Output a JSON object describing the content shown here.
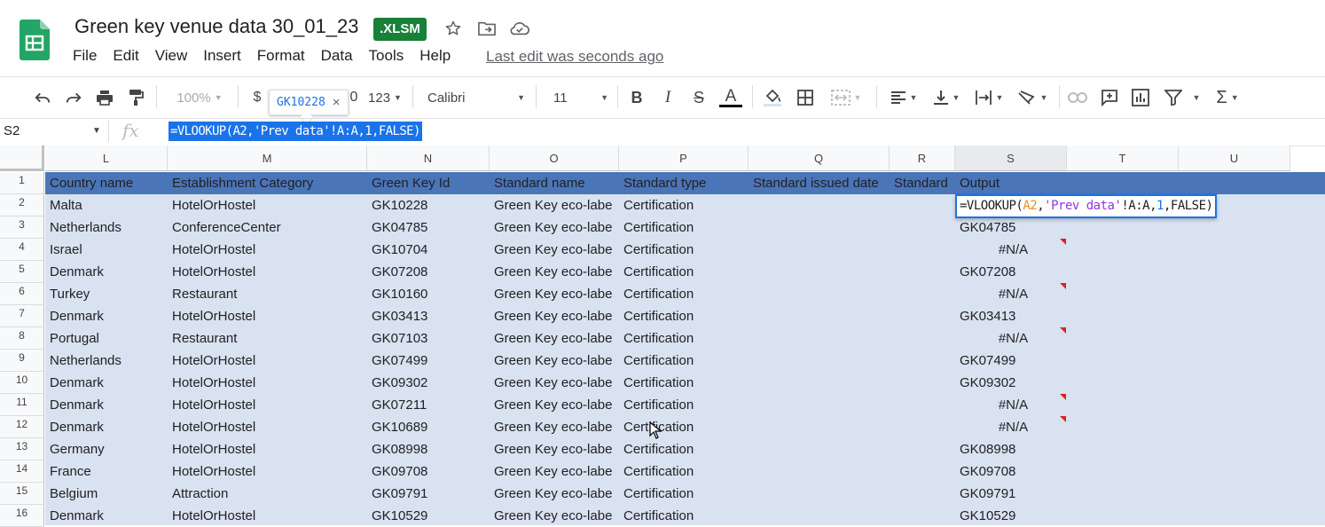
{
  "title": "Green key venue data 30_01_23",
  "badge": ".XLSM",
  "menu": [
    "File",
    "Edit",
    "View",
    "Insert",
    "Format",
    "Data",
    "Tools",
    "Help"
  ],
  "last_edit": "Last edit was seconds ago",
  "toolbar": {
    "zoom": "100%",
    "currency": "$",
    "decimals_partial": "0",
    "number_format": "123",
    "font": "Calibri",
    "font_size": "11",
    "bold": "B",
    "italic": "I",
    "strike": "S",
    "text_color": "A"
  },
  "tooltip": {
    "value": "GK10228",
    "close": "×"
  },
  "name_box": "S2",
  "fx_label": "fx",
  "formula": "=VLOOKUP(A2,'Prev data'!A:A,1,FALSE)",
  "editor": {
    "prefix": "=VLOOKUP(",
    "ref1": "A2",
    "comma1": ",",
    "str": "'Prev data'",
    "range": "!A:A,",
    "num": "1",
    "suffix": ",FALSE)"
  },
  "columns": [
    "L",
    "M",
    "N",
    "O",
    "P",
    "Q",
    "R",
    "S",
    "T",
    "U"
  ],
  "header_row": [
    "Country name",
    "Establishment Category",
    "Green Key Id",
    "Standard name",
    "Standard type",
    "Standard issued date",
    "Standard",
    "Output"
  ],
  "rows": [
    {
      "n": "1"
    },
    {
      "n": "2",
      "country": "Malta",
      "category": "HotelOrHostel",
      "id": "GK10228",
      "std": "Green Key eco-labe",
      "type": "Certification",
      "out": ""
    },
    {
      "n": "3",
      "country": "Netherlands",
      "category": "ConferenceCenter",
      "id": "GK04785",
      "std": "Green Key eco-labe",
      "type": "Certification",
      "out": "GK04785"
    },
    {
      "n": "4",
      "country": "Israel",
      "category": "HotelOrHostel",
      "id": "GK10704",
      "std": "Green Key eco-labe",
      "type": "Certification",
      "out": "#N/A"
    },
    {
      "n": "5",
      "country": "Denmark",
      "category": "HotelOrHostel",
      "id": "GK07208",
      "std": "Green Key eco-labe",
      "type": "Certification",
      "out": "GK07208"
    },
    {
      "n": "6",
      "country": "Turkey",
      "category": "Restaurant",
      "id": "GK10160",
      "std": "Green Key eco-labe",
      "type": "Certification",
      "out": "#N/A"
    },
    {
      "n": "7",
      "country": "Denmark",
      "category": "HotelOrHostel",
      "id": "GK03413",
      "std": "Green Key eco-labe",
      "type": "Certification",
      "out": "GK03413"
    },
    {
      "n": "8",
      "country": "Portugal",
      "category": "Restaurant",
      "id": "GK07103",
      "std": "Green Key eco-labe",
      "type": "Certification",
      "out": "#N/A"
    },
    {
      "n": "9",
      "country": "Netherlands",
      "category": "HotelOrHostel",
      "id": "GK07499",
      "std": "Green Key eco-labe",
      "type": "Certification",
      "out": "GK07499"
    },
    {
      "n": "10",
      "country": "Denmark",
      "category": "HotelOrHostel",
      "id": "GK09302",
      "std": "Green Key eco-labe",
      "type": "Certification",
      "out": "GK09302"
    },
    {
      "n": "11",
      "country": "Denmark",
      "category": "HotelOrHostel",
      "id": "GK07211",
      "std": "Green Key eco-labe",
      "type": "Certification",
      "out": "#N/A"
    },
    {
      "n": "12",
      "country": "Denmark",
      "category": "HotelOrHostel",
      "id": "GK10689",
      "std": "Green Key eco-labe",
      "type": "Certification",
      "out": "#N/A"
    },
    {
      "n": "13",
      "country": "Germany",
      "category": "HotelOrHostel",
      "id": "GK08998",
      "std": "Green Key eco-labe",
      "type": "Certification",
      "out": "GK08998"
    },
    {
      "n": "14",
      "country": "France",
      "category": "HotelOrHostel",
      "id": "GK09708",
      "std": "Green Key eco-labe",
      "type": "Certification",
      "out": "GK09708"
    },
    {
      "n": "15",
      "country": "Belgium",
      "category": "Attraction",
      "id": "GK09791",
      "std": "Green Key eco-labe",
      "type": "Certification",
      "out": "GK09791"
    },
    {
      "n": "16",
      "country": "Denmark",
      "category": "HotelOrHostel",
      "id": "GK10529",
      "std": "Green Key eco-labe",
      "type": "Certification",
      "out": "GK10529"
    }
  ],
  "colors": {
    "header_fill": "#4a75b8",
    "band_fill": "#d9e2f0",
    "accent": "#1a73e8",
    "error_marker": "#e02020",
    "brand_green": "#188038"
  }
}
